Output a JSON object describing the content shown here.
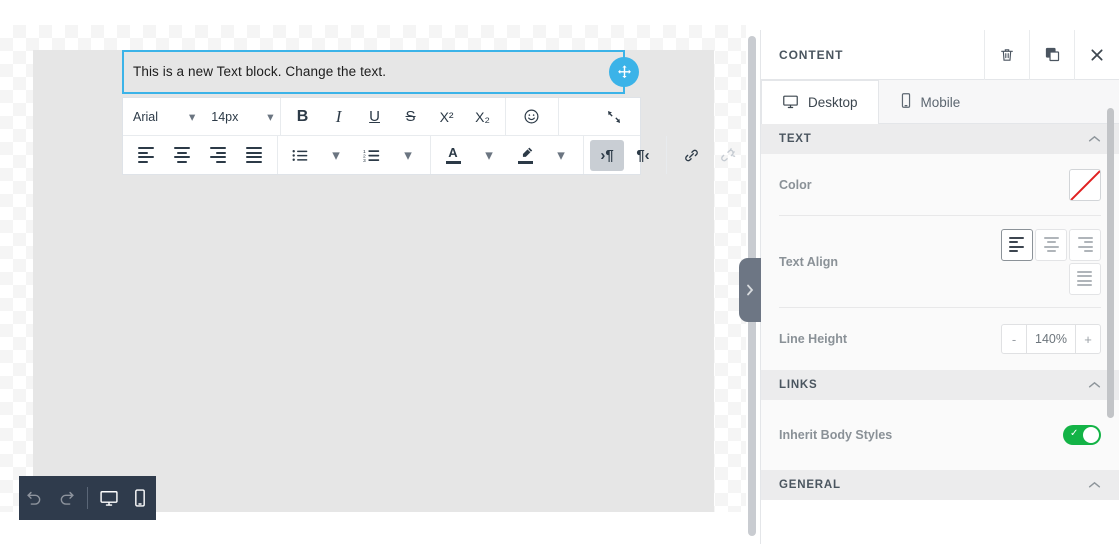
{
  "canvas": {
    "text_block": {
      "content": "This is a new Text block. Change the text.",
      "drag_handle_icon": "move-arrows-icon"
    }
  },
  "editor_toolbar": {
    "font_family": "Arial",
    "font_size": "14px",
    "buttons": {
      "bold": "B",
      "italic": "I",
      "underline": "U",
      "strikethrough": "S",
      "superscript": "X²",
      "subscript": "X₂",
      "emoji": "emoji-icon",
      "collapse": "collapse-toolbar-icon",
      "align_left": "align-left-icon",
      "align_center": "align-center-icon",
      "align_right": "align-right-icon",
      "align_justify": "align-justify-icon",
      "bullet_list": "bulleted-list-icon",
      "numbered_list": "numbered-list-icon",
      "text_color": "A",
      "highlight": "highlight-pen-icon",
      "ltr": "ltr-paragraph-icon",
      "rtl": "rtl-paragraph-icon",
      "link": "link-icon",
      "unlink": "unlink-icon"
    }
  },
  "bottom_toolbar": {
    "undo": "undo-icon",
    "redo": "redo-icon",
    "desktop_preview": "desktop-icon",
    "mobile_preview": "mobile-icon"
  },
  "collapse_tab": {
    "icon": "chevron-right-icon"
  },
  "panel": {
    "title": "CONTENT",
    "header_actions": [
      {
        "name": "delete-button",
        "icon": "trash-icon"
      },
      {
        "name": "duplicate-button",
        "icon": "duplicate-icon"
      },
      {
        "name": "close-button",
        "icon": "close-icon"
      }
    ],
    "tabs": [
      {
        "label": "Desktop",
        "icon": "desktop-icon",
        "active": true
      },
      {
        "label": "Mobile",
        "icon": "mobile-icon",
        "active": false
      }
    ],
    "sections": [
      {
        "title": "TEXT",
        "collapsed": false,
        "rows": [
          {
            "label": "Color",
            "type": "color",
            "value": "none"
          },
          {
            "label": "Text Align",
            "type": "align",
            "value": "left"
          },
          {
            "label": "Line Height",
            "type": "stepper",
            "value": "140%",
            "minus": "-",
            "plus": "+"
          }
        ]
      },
      {
        "title": "LINKS",
        "collapsed": false,
        "rows": [
          {
            "label": "Inherit Body Styles",
            "type": "toggle",
            "value": "on"
          }
        ]
      },
      {
        "title": "GENERAL",
        "collapsed": false,
        "rows": []
      }
    ]
  },
  "colors": {
    "accent_blue": "#3bb3e8",
    "toggle_green": "#13b346",
    "swatch_slash_red": "#e02020",
    "dark_toolbar": "#2f3b4c"
  }
}
